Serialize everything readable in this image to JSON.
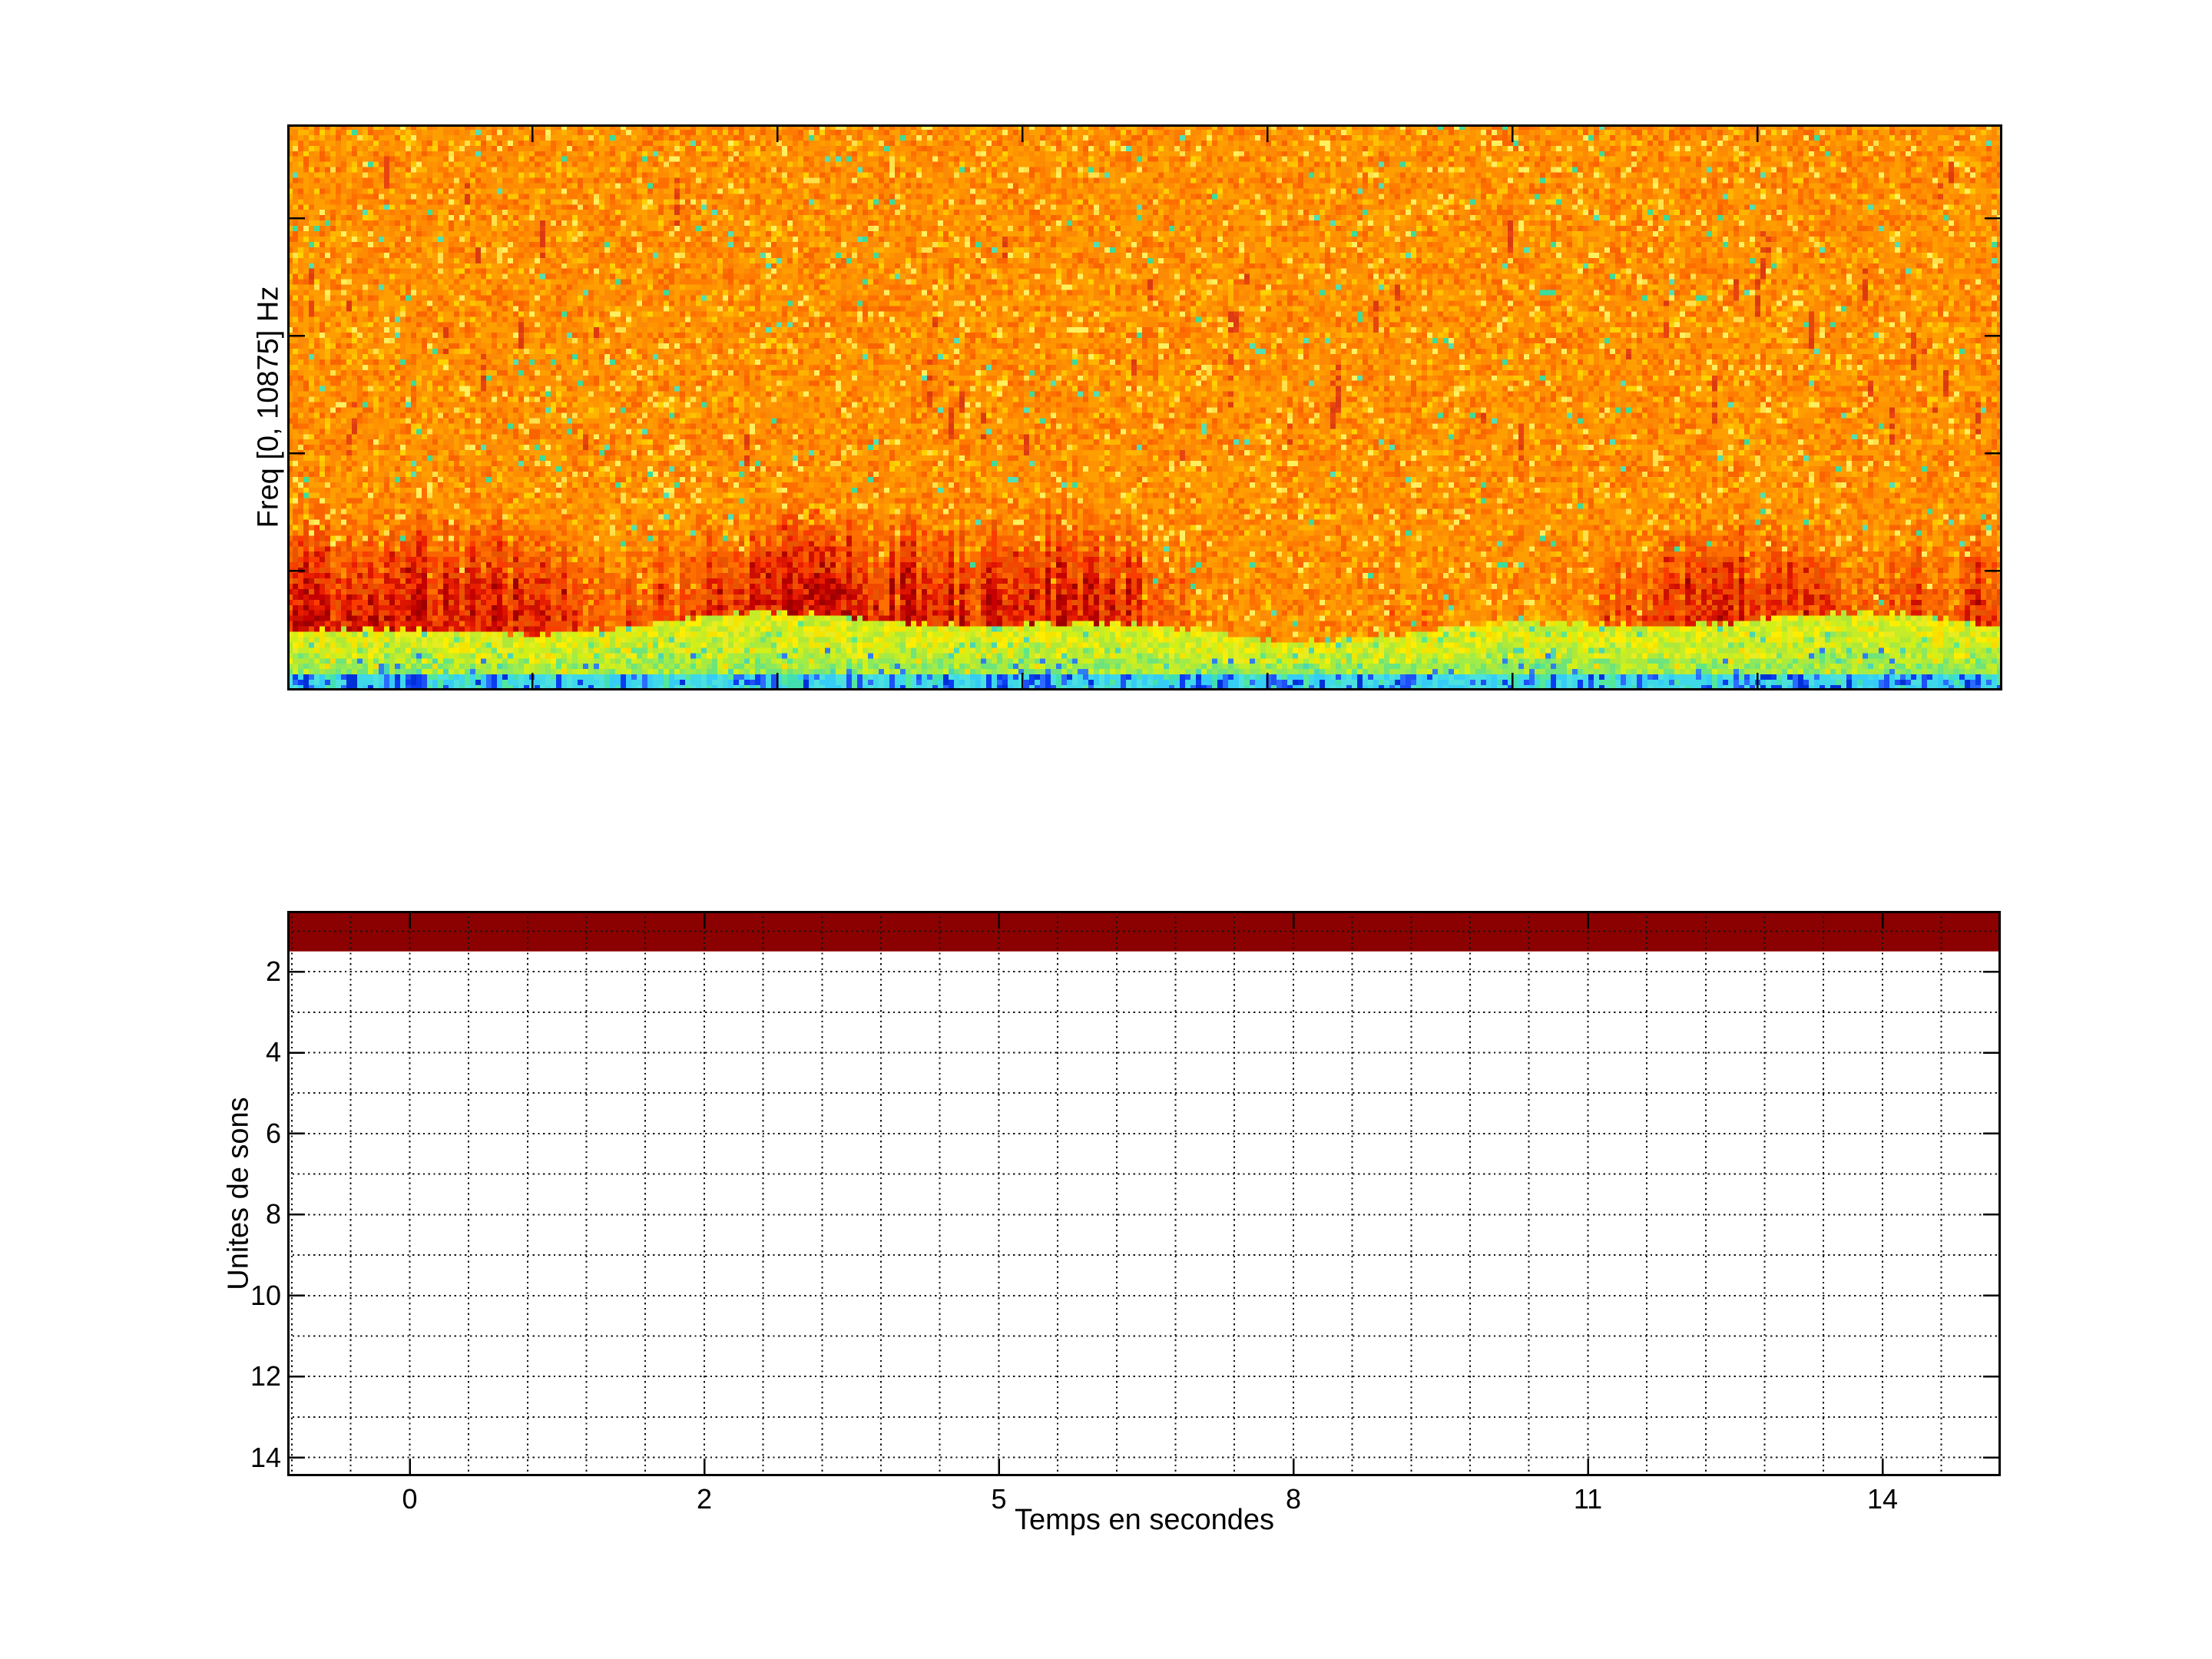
{
  "figure": {
    "background": "#ffffff"
  },
  "spectrogram": {
    "ylabel": "Freq [0, 10875] Hz",
    "freq_range_hz": [
      0,
      10875
    ],
    "colormap": "jet",
    "n_x_ticks": 6,
    "n_y_ticks": 4,
    "palette": {
      "orange_base": [
        "#ff8c00",
        "#ff9300",
        "#fb8a06",
        "#ff9e00",
        "#ff7c00"
      ],
      "orange_deep": [
        "#ff6f00",
        "#f96400"
      ],
      "yellow_speckle": [
        "#ffd200",
        "#ffe14c",
        "#ffc400",
        "#fff060"
      ],
      "teal_speckle": [
        "#3cdc9b",
        "#52e0b4"
      ],
      "wisp": [
        "#e8440f",
        "#dc3a10"
      ],
      "red_light": [
        "#fa3c00",
        "#f04800",
        "#e85500"
      ],
      "red_mid": [
        "#dc1400",
        "#e81e00",
        "#cc1000"
      ],
      "red_dark": [
        "#b40000",
        "#c60000",
        "#9e0000"
      ],
      "green_top": [
        "#f4e400",
        "#ffee00",
        "#e8ec20"
      ],
      "green_mid": [
        "#c4ec28",
        "#b0e838",
        "#d2f018"
      ],
      "green_low": [
        "#8ce85c",
        "#6ee47a",
        "#a0ec48"
      ],
      "green_speckle": [
        "#ffd800",
        "#49d6b4",
        "#5ae88a"
      ],
      "blue_dot": "#2e7ef0",
      "cyan_base": [
        "#3ed8e8",
        "#4ce0de",
        "#35cdf5"
      ],
      "cyan_blue": [
        "#2b6bff",
        "#1e50f5"
      ],
      "cyan_darkblue": [
        "#0a3cf0",
        "#0030d8"
      ],
      "cyan_green": [
        "#53e89a",
        "#42e0b0"
      ]
    }
  },
  "sound_units_plot": {
    "xlabel": "Temps en secondes",
    "ylabel": "Unites de sons",
    "x_tick_labels": [
      "0",
      "2",
      "5",
      "8",
      "11",
      "14"
    ],
    "y_tick_labels": [
      "2",
      "4",
      "6",
      "8",
      "10",
      "12",
      "14"
    ],
    "bar_color": "#8b0000",
    "grid_color": "#141414",
    "axis_color": "#000000",
    "rows": 14,
    "filled_row": 1
  },
  "chart_data": [
    {
      "type": "heatmap",
      "title": "",
      "xlabel": "",
      "ylabel": "Freq [0, 10875] Hz",
      "y_axis": {
        "range_hz": [
          0,
          10875
        ],
        "tick_labels": [],
        "n_unlabeled_ticks": 4
      },
      "x_axis": {
        "tick_labels": [],
        "n_unlabeled_ticks": 6
      },
      "colormap": "jet",
      "content_summary": "Broadband noise spectrogram: upper ~60% of band is high-energy orange/yellow speckle with sparse faint red vertical wisps and rare teal dots; a band of strong dark-red vertical striations occupies the lower-mid frequencies; below it a yellow-to-green band, then a thin cyan stripe with vertical blue flecks at the lowest frequencies."
    },
    {
      "type": "heatmap",
      "title": "",
      "xlabel": "Temps en secondes",
      "ylabel": "Unites de sons",
      "x_tick_labels": [
        "0",
        "2",
        "5",
        "8",
        "11",
        "14"
      ],
      "x_tick_positions_frac": [
        0.0715,
        0.2434,
        0.4153,
        0.5872,
        0.7591,
        0.931
      ],
      "y_tick_labels": [
        "2",
        "4",
        "6",
        "8",
        "10",
        "12",
        "14"
      ],
      "ylim": [
        0.5,
        14.5
      ],
      "rows": 14,
      "values_summary": "Row 1 (sound unit 1) is a solid dark-red (#8b0000) bar spanning the entire time axis; rows 2-14 contain no data (white).",
      "grid": "dotted grid on (minor vertical gridlines at 1/5 of major tick spacing, horizontal gridlines at every integer unit)",
      "legend": "none"
    }
  ]
}
